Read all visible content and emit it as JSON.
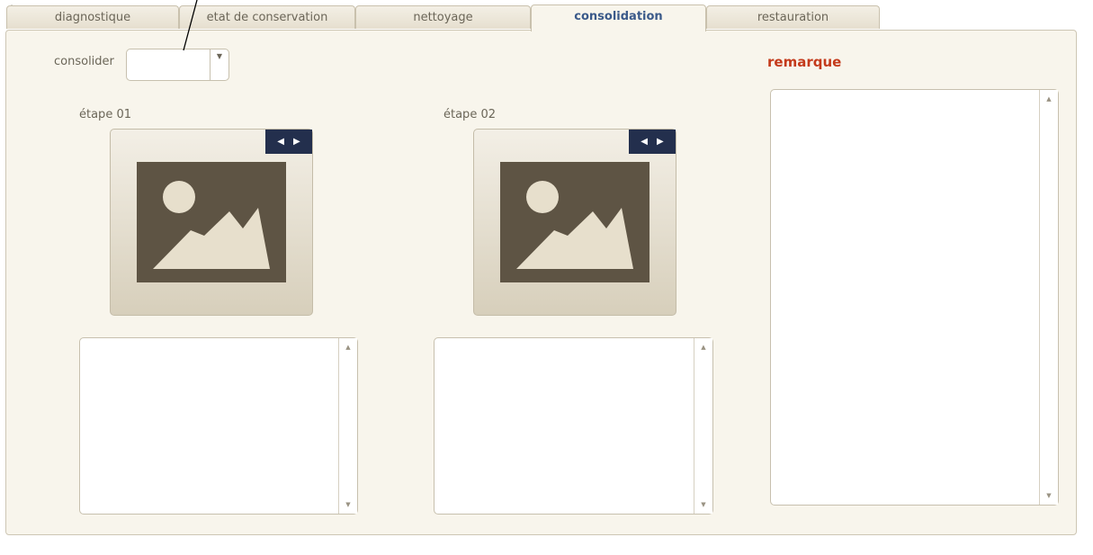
{
  "toolbar": {
    "plus_symbol": "+"
  },
  "tabs": [
    {
      "label": "diagnostique",
      "active": false
    },
    {
      "label": "etat de conservation",
      "active": false
    },
    {
      "label": "nettoyage",
      "active": false
    },
    {
      "label": "consolidation",
      "active": true
    },
    {
      "label": "restauration",
      "active": false
    }
  ],
  "form": {
    "consolider_label": "consolider",
    "consolider_value": "",
    "combo_arrow_icon": "dropdown-arrow-icon"
  },
  "steps": [
    {
      "label": "étape 01",
      "image_icon": "image-placeholder-icon",
      "nav_prev": "◀",
      "nav_next": "▶",
      "notes": ""
    },
    {
      "label": "étape 02",
      "image_icon": "image-placeholder-icon",
      "nav_prev": "◀",
      "nav_next": "▶",
      "notes": ""
    }
  ],
  "remarque": {
    "title": "remarque",
    "text": ""
  },
  "scroll": {
    "up": "▲",
    "down": "▼"
  },
  "colors": {
    "active_tab_text": "#3b5a8a",
    "remarque_title": "#c43a1b",
    "panel_bg": "#f8f5ec",
    "nav_bg": "#232f4d",
    "image_icon": "#5e5444"
  }
}
